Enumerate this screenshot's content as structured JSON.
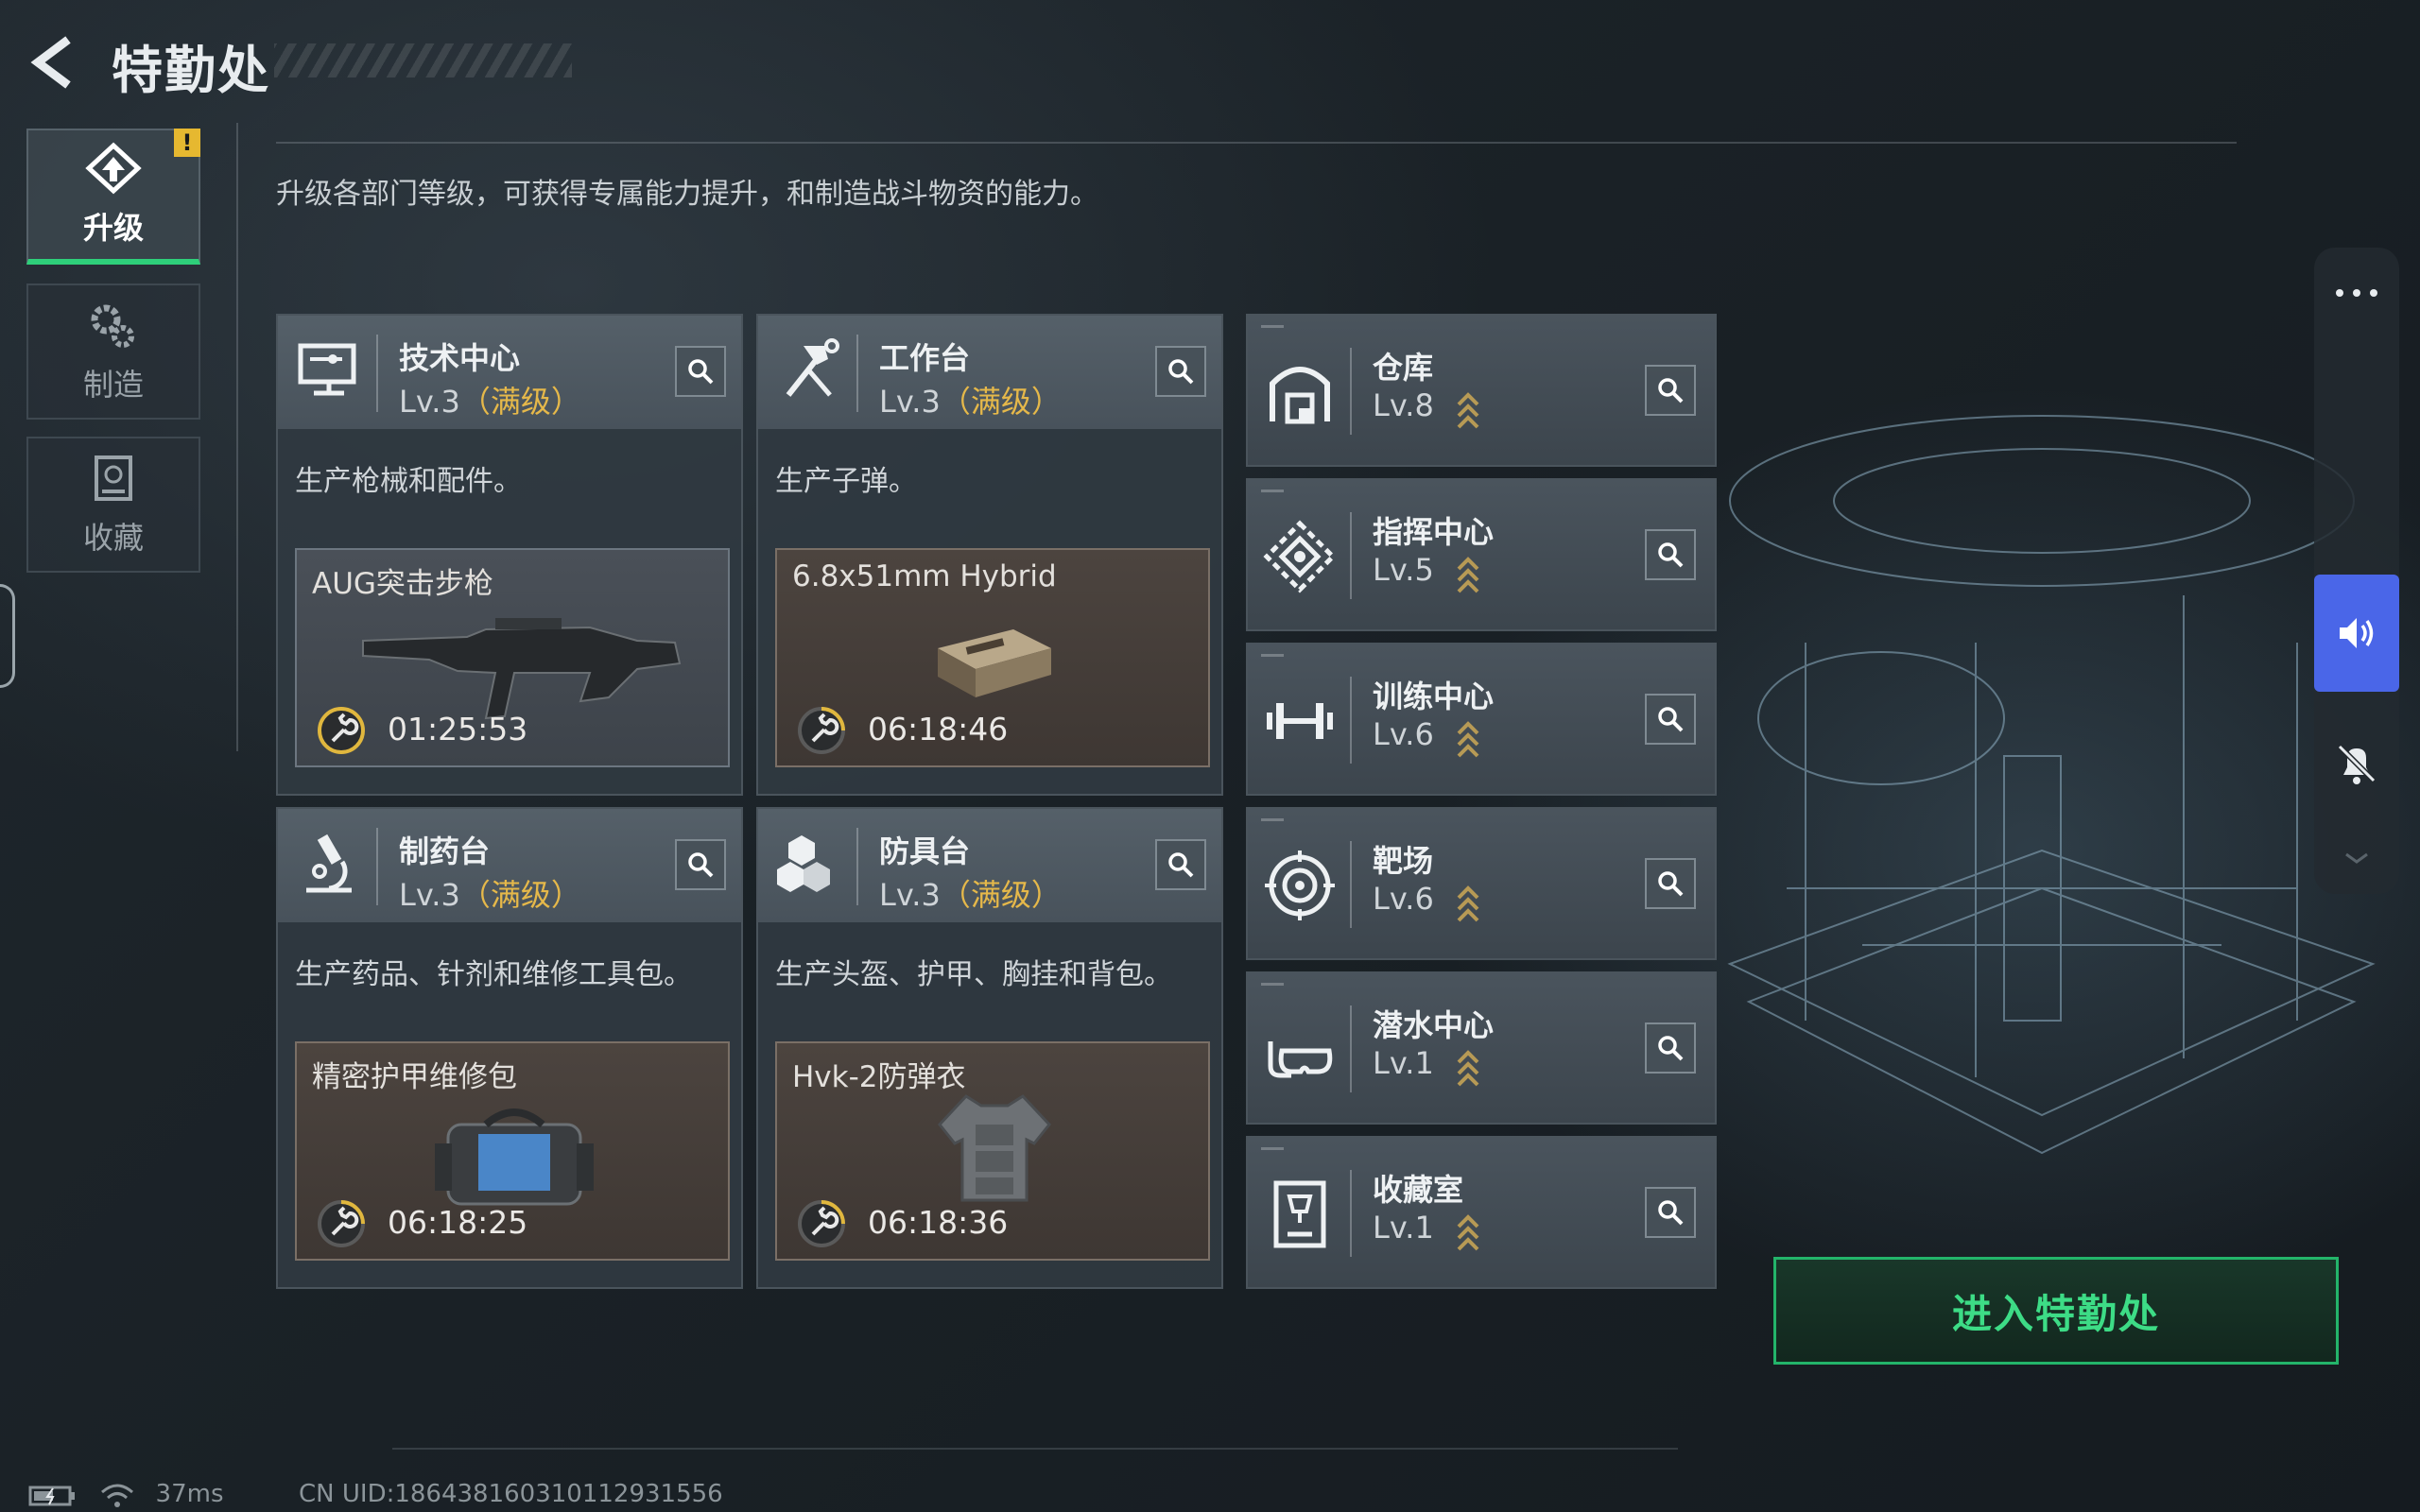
{
  "header": {
    "title": "特勤处"
  },
  "nav": [
    {
      "label": "升级",
      "icon": "upgrade-icon",
      "active": true,
      "alert": "!"
    },
    {
      "label": "制造",
      "icon": "gears-icon",
      "active": false
    },
    {
      "label": "收藏",
      "icon": "collection-icon",
      "active": false
    }
  ],
  "description": "升级各部门等级，可获得专属能力提升，和制造战斗物资的能力。",
  "production": [
    {
      "name": "技术中心",
      "level": "Lv.3",
      "max": "（满级）",
      "desc": "生产枪械和配件。",
      "item": "AUG突击步枪",
      "timer": "01:25:53",
      "icon": "computer-icon"
    },
    {
      "name": "工作台",
      "level": "Lv.3",
      "max": "（满级）",
      "desc": "生产子弹。",
      "item": "6.8x51mm Hybrid",
      "timer": "06:18:46",
      "icon": "tools-icon"
    },
    {
      "name": "制药台",
      "level": "Lv.3",
      "max": "（满级）",
      "desc": "生产药品、针剂和维修工具包。",
      "item": "精密护甲维修包",
      "timer": "06:18:25",
      "icon": "microscope-icon"
    },
    {
      "name": "防具台",
      "level": "Lv.3",
      "max": "（满级）",
      "desc": "生产头盔、护甲、胸挂和背包。",
      "item": "Hvk-2防弹衣",
      "timer": "06:18:36",
      "icon": "boxes-icon"
    }
  ],
  "departments": [
    {
      "name": "仓库",
      "level": "Lv.8",
      "icon": "warehouse-icon"
    },
    {
      "name": "指挥中心",
      "level": "Lv.5",
      "icon": "command-icon"
    },
    {
      "name": "训练中心",
      "level": "Lv.6",
      "icon": "dumbbell-icon"
    },
    {
      "name": "靶场",
      "level": "Lv.6",
      "icon": "target-icon"
    },
    {
      "name": "潜水中心",
      "level": "Lv.1",
      "icon": "diving-mask-icon"
    },
    {
      "name": "收藏室",
      "level": "Lv.1",
      "icon": "trophy-case-icon"
    }
  ],
  "enter_button": "进入特勤处",
  "status": {
    "ping": "37ms",
    "uid": "CN UID:1864381603101129315​56"
  },
  "colors": {
    "accent_green": "#2ecf7a",
    "gold": "#e5b84a",
    "sound_blue": "#4a66e8"
  }
}
